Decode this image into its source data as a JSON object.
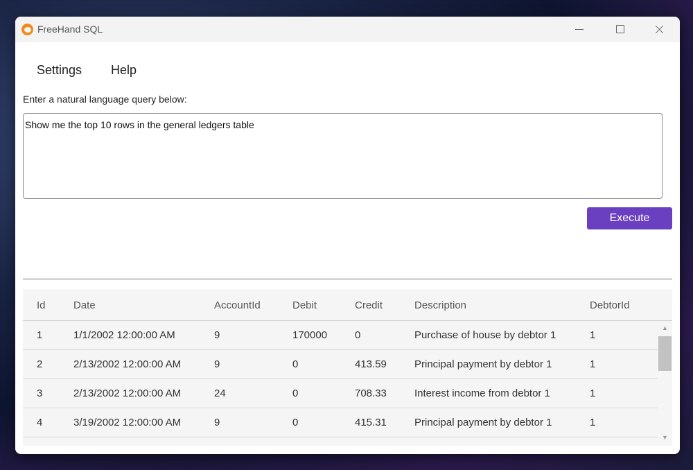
{
  "window": {
    "title": "FreeHand SQL"
  },
  "menu": {
    "items": [
      "Settings",
      "Help"
    ]
  },
  "prompt": {
    "label": "Enter a natural language query below:"
  },
  "query": {
    "value": "Show me the top 10 rows in the general ledgers table"
  },
  "execute": {
    "label": "Execute"
  },
  "colors": {
    "accent": "#6a3fc0",
    "app_icon": "#f08a1c"
  },
  "table": {
    "columns": [
      "Id",
      "Date",
      "AccountId",
      "Debit",
      "Credit",
      "Description",
      "DebtorId"
    ],
    "rows": [
      [
        "1",
        "1/1/2002 12:00:00 AM",
        "9",
        "170000",
        "0",
        "Purchase of house by debtor 1",
        "1"
      ],
      [
        "2",
        "2/13/2002 12:00:00 AM",
        "9",
        "0",
        "413.59",
        "Principal payment by debtor 1",
        "1"
      ],
      [
        "3",
        "2/13/2002 12:00:00 AM",
        "24",
        "0",
        "708.33",
        "Interest income from debtor 1",
        "1"
      ],
      [
        "4",
        "3/19/2002 12:00:00 AM",
        "9",
        "0",
        "415.31",
        "Principal payment by debtor 1",
        "1"
      ]
    ]
  }
}
